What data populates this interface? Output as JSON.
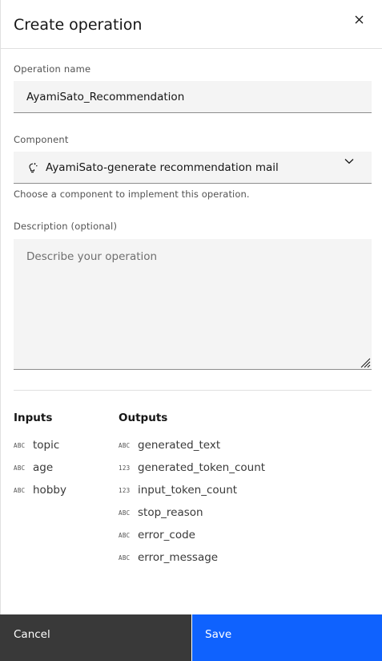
{
  "header": {
    "title": "Create operation",
    "close_icon": "close-icon"
  },
  "form": {
    "operation_name": {
      "label": "Operation name",
      "value": "AyamiSato_Recommendation"
    },
    "component": {
      "label": "Component",
      "value": "AyamiSato-generate recommendation mail",
      "icon": "lightbulb-icon",
      "helper": "Choose a component to implement this operation."
    },
    "description": {
      "label": "Description (optional)",
      "placeholder": "Describe your operation"
    }
  },
  "io": {
    "inputs_label": "Inputs",
    "outputs_label": "Outputs",
    "inputs": [
      {
        "type": "ABC",
        "name": "topic"
      },
      {
        "type": "ABC",
        "name": "age"
      },
      {
        "type": "ABC",
        "name": "hobby"
      }
    ],
    "outputs": [
      {
        "type": "ABC",
        "name": "generated_text"
      },
      {
        "type": "123",
        "name": "generated_token_count"
      },
      {
        "type": "123",
        "name": "input_token_count"
      },
      {
        "type": "ABC",
        "name": "stop_reason"
      },
      {
        "type": "ABC",
        "name": "error_code"
      },
      {
        "type": "ABC",
        "name": "error_message"
      }
    ]
  },
  "footer": {
    "cancel_label": "Cancel",
    "save_label": "Save"
  },
  "colors": {
    "primary": "#0f62fe",
    "secondary": "#393939",
    "field_bg": "#f4f4f4"
  }
}
